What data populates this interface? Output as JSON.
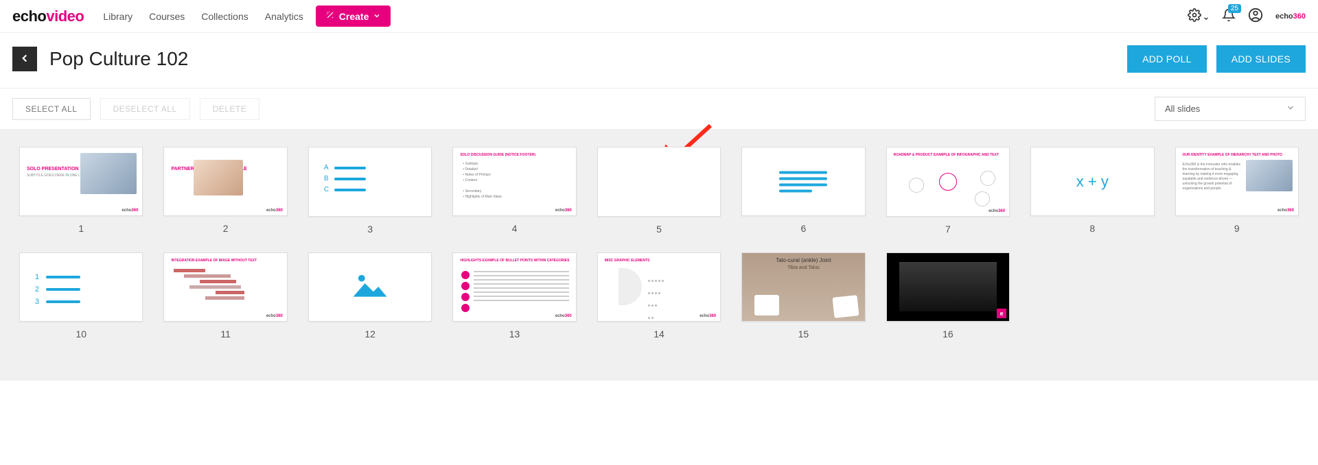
{
  "brand": {
    "part1": "echo",
    "part2": "video"
  },
  "nav": {
    "library": "Library",
    "courses": "Courses",
    "collections": "Collections",
    "analytics": "Analytics"
  },
  "create_label": "Create",
  "notification_count": "25",
  "mini_brand": {
    "part1": "echo",
    "part2": "360"
  },
  "page_title": "Pop Culture 102",
  "cta": {
    "add_poll": "ADD POLL",
    "add_slides": "ADD SLIDES"
  },
  "toolbar": {
    "select_all": "SELECT ALL",
    "deselect_all": "DESELECT ALL",
    "delete": "DELETE"
  },
  "filter": {
    "label": "All slides"
  },
  "slides": [
    {
      "n": "1"
    },
    {
      "n": "2"
    },
    {
      "n": "3"
    },
    {
      "n": "4"
    },
    {
      "n": "5"
    },
    {
      "n": "6"
    },
    {
      "n": "7"
    },
    {
      "n": "8"
    },
    {
      "n": "9"
    },
    {
      "n": "10"
    },
    {
      "n": "11"
    },
    {
      "n": "12"
    },
    {
      "n": "13"
    },
    {
      "n": "14"
    },
    {
      "n": "15"
    },
    {
      "n": "16"
    }
  ],
  "thumb_text": {
    "s1_title": "SOLO PRESENTATION TITLE",
    "s1_sub": "SUBTITLE GOES HERE IN ONE LINE ONLY",
    "s2_title": "PARTNER PRESENTATION TITLE",
    "s3_a": "A",
    "s3_b": "B",
    "s3_c": "C",
    "s4_head": "SOLO DISCUSSION GUIDE (NOTICE FOOTER)",
    "s7_head": "ROADMAP & PRODUCT  EXAMPLE OF INFOGRAPHIC AND TEXT",
    "s8_formula": "x + y",
    "s9_head": "OUR IDENTITY  EXAMPLE OF HIERARCHY TEXT AND PHOTO",
    "s11_head": "INTEGRATION  EXAMPLE OF IMAGE WITHOUT TEXT",
    "s13_head": "HIGHLIGHTS  EXAMPLE OF BULLET POINTS WITHIN CATEGORIES",
    "s14_head": "MISC  GRAPHIC ELEMENTS",
    "s15_title": "Talo-cural (ankle) Joint",
    "s15_sub": "Tibia and Talus",
    "footer_brand": "echo360"
  }
}
